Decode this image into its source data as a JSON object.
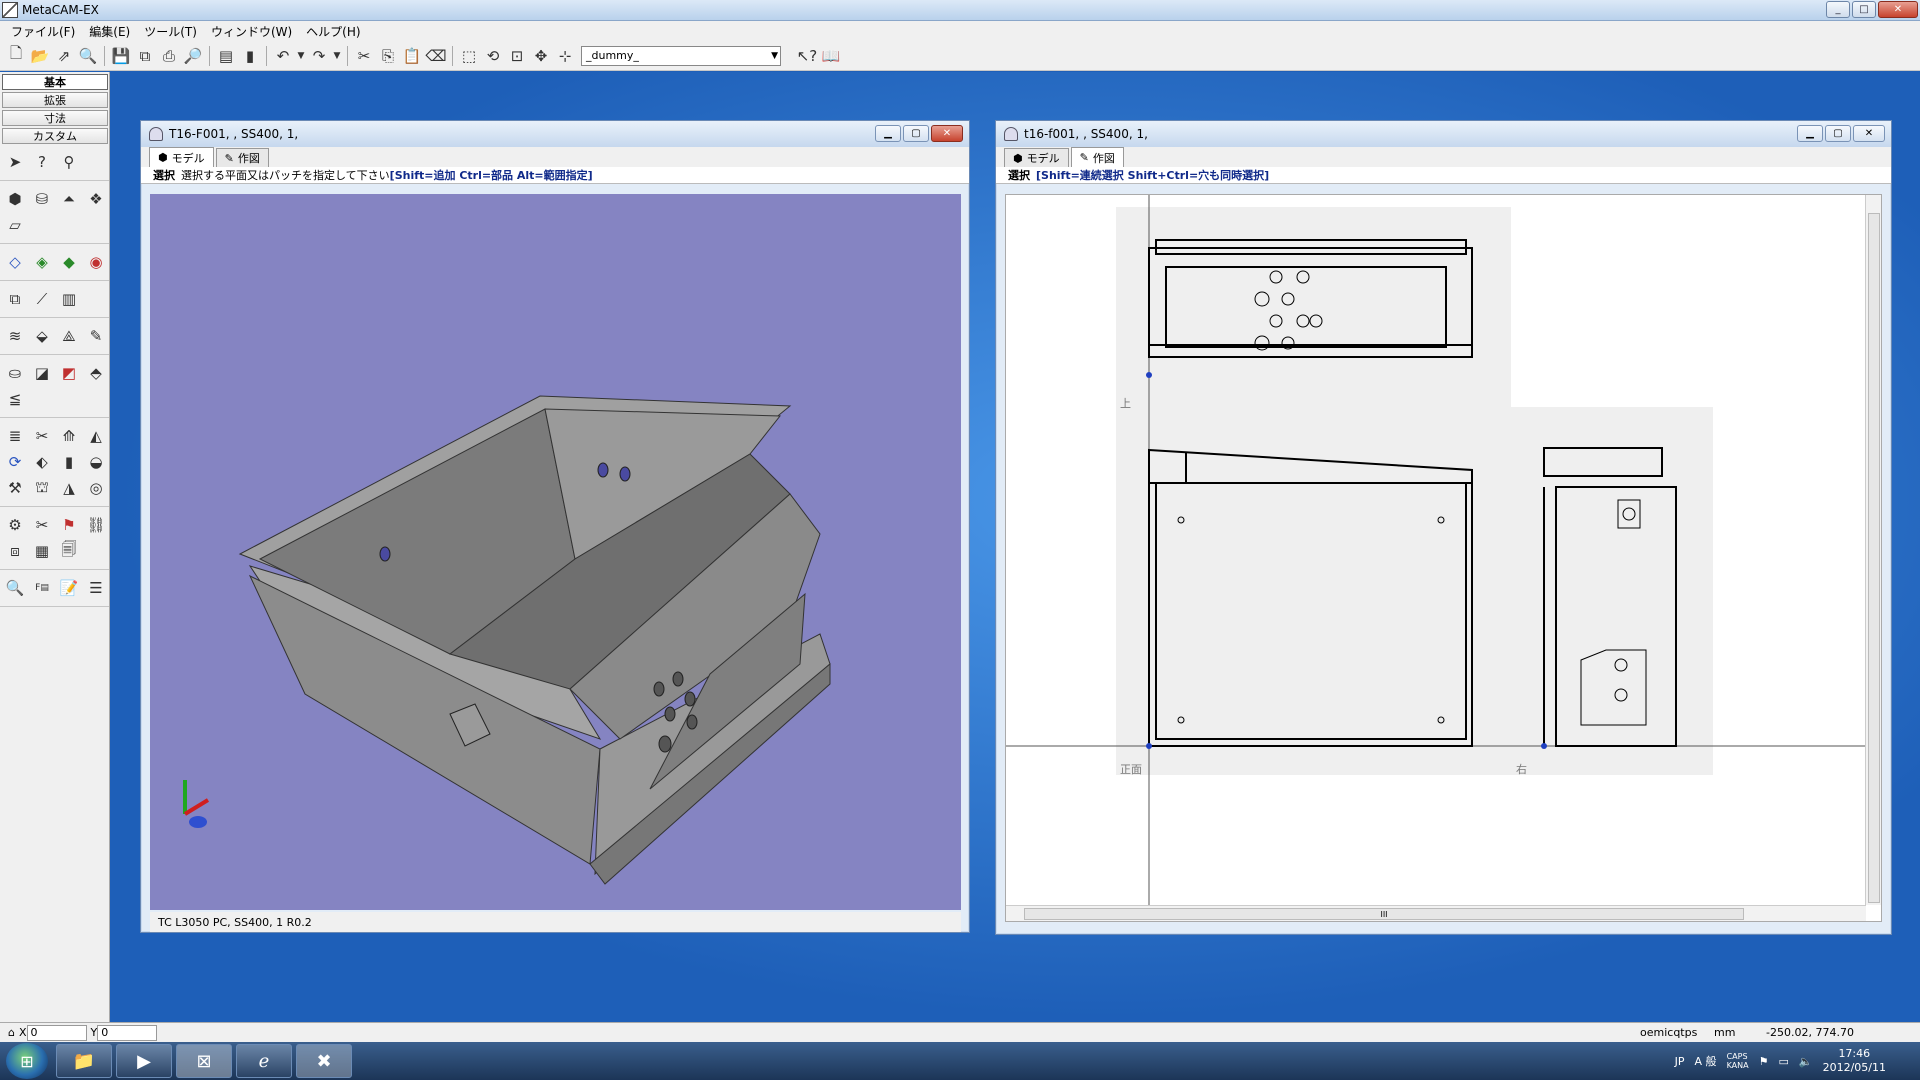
{
  "app": {
    "title": "MetaCAM-EX",
    "window_controls": [
      "_",
      "□",
      "✕"
    ]
  },
  "menubar": {
    "items": [
      "ファイル(F)",
      "編集(E)",
      "ツール(T)",
      "ウィンドウ(W)",
      "ヘルプ(H)"
    ]
  },
  "toolbar": {
    "combo_value": "_dummy_",
    "icons": [
      "new-file-icon",
      "open-folder-icon",
      "export-icon",
      "search-icon",
      "save-icon",
      "save-all-icon",
      "print-icon",
      "print-preview-icon",
      "properties-icon",
      "clipboard-icon",
      "undo-icon",
      "redo-icon",
      "cut-icon",
      "copy-icon",
      "paste-icon",
      "eraser-icon",
      "zoom-window-icon",
      "zoom-previous-icon",
      "zoom-fit-icon",
      "pan-icon",
      "axis-icon",
      "help-pointer-icon",
      "book-icon"
    ]
  },
  "left_panel": {
    "tabs": [
      "基本",
      "拡張",
      "寸法",
      "カスタム"
    ],
    "active_tab": "基本"
  },
  "window_model": {
    "title": "T16-F001, , SS400, 1,",
    "tabs": [
      "モデル",
      "作図"
    ],
    "active_tab": "モデル",
    "prompt_label": "選択",
    "prompt_text": "選択する平面又はパッチを指定して下さい",
    "prompt_hint": "[Shift=追加 Ctrl=部品 Alt=範囲指定]",
    "status": "TC L3050 PC, SS400, 1 R0.2",
    "viewport_color": "#8584c2"
  },
  "window_drawing": {
    "title": "t16-f001, , SS400, 1,",
    "tabs": [
      "モデル",
      "作図"
    ],
    "active_tab": "作図",
    "prompt_label": "選択",
    "prompt_hint": "[Shift=連続選択 Shift+Ctrl=穴も同時選択]",
    "view_labels": {
      "top": "上",
      "front": "正面",
      "right": "右"
    },
    "scroll_grip": "III"
  },
  "statusbar": {
    "x_label": "X",
    "x_value": "0",
    "y_label": "Y",
    "y_value": "0",
    "user": "oemicqtps",
    "unit": "mm",
    "coords": "-250.02, 774.70"
  },
  "taskbar": {
    "language": "JP",
    "ime": "A 般",
    "caps": "CAPS",
    "kana": "KANA",
    "time": "17:46",
    "date": "2012/05/11"
  }
}
